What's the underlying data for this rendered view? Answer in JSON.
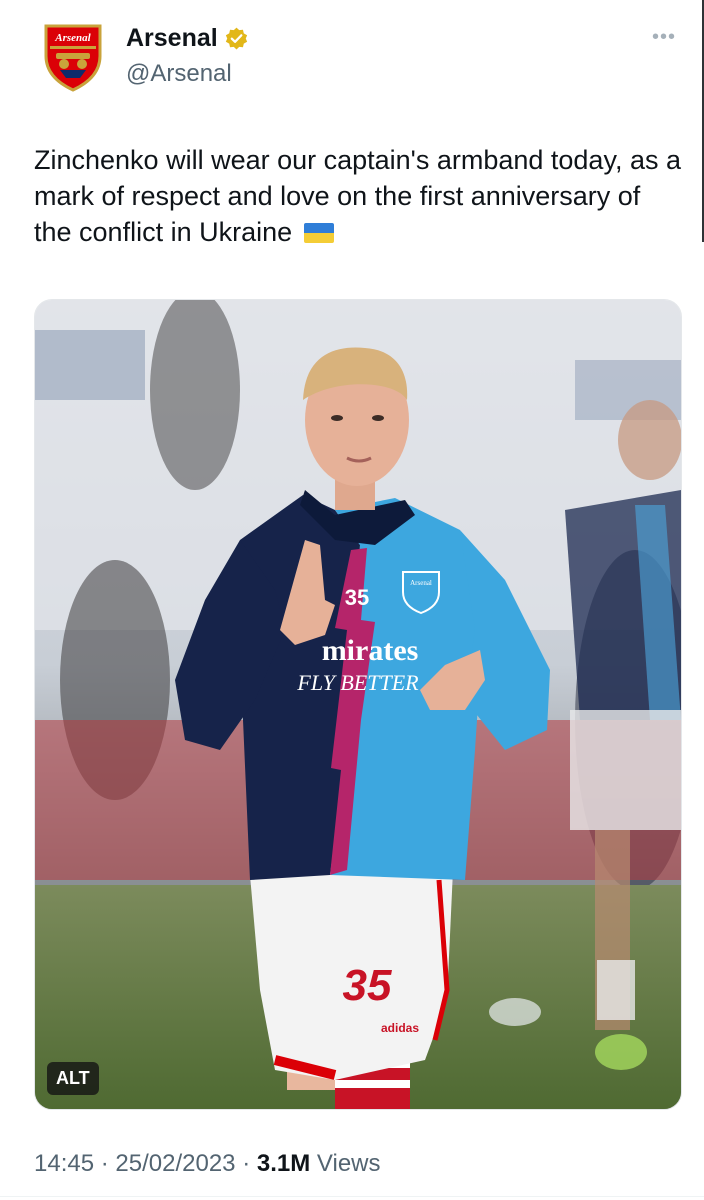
{
  "account": {
    "display_name": "Arsenal",
    "handle": "@Arsenal",
    "avatar_text": "Arsenal",
    "verified_color": "#e2b719"
  },
  "tweet": {
    "text": "Zinchenko will wear our captain's armband today, as a mark of respect and love on the first anniversary of the conflict in Ukraine",
    "flag": "ukraine-flag"
  },
  "media": {
    "alt_label": "ALT",
    "shirt_number": "35",
    "sponsor_line1": "mirates",
    "sponsor_line2": "FLY BETTER",
    "crest_text": "Arsenal",
    "shorts_brand": "adidas"
  },
  "meta": {
    "time": "14:45",
    "separator": "·",
    "date": "25/02/2023",
    "views_count": "3.1M",
    "views_label": "Views"
  },
  "colors": {
    "accent": "#1d9bf0",
    "text": "#0f1419",
    "secondary": "#536471",
    "arsenal_red": "#db0007"
  }
}
